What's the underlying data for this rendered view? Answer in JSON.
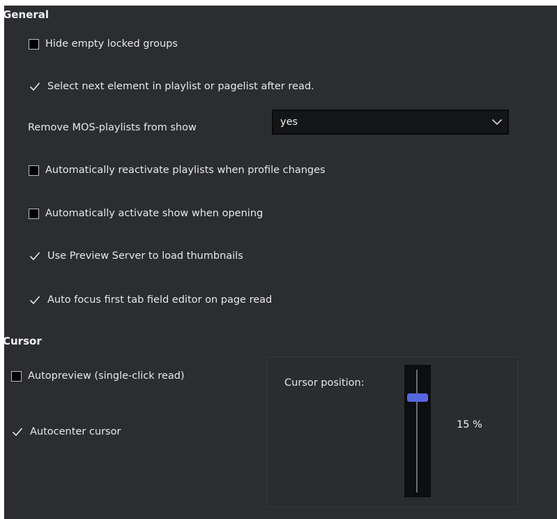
{
  "general": {
    "title": "General",
    "options": [
      {
        "label": "Hide empty locked groups",
        "type": "checkbox",
        "checked": false
      },
      {
        "label": "Select next element in playlist or pagelist after read.",
        "type": "check",
        "checked": true
      },
      {
        "label": "Automatically reactivate playlists when profile changes",
        "type": "checkbox",
        "checked": false
      },
      {
        "label": "Automatically activate show when opening",
        "type": "checkbox",
        "checked": false
      },
      {
        "label": "Use Preview Server to load thumbnails",
        "type": "check",
        "checked": true
      },
      {
        "label": "Auto focus first tab field editor on page read",
        "type": "check",
        "checked": true
      }
    ],
    "remove_mos": {
      "label": "Remove MOS-playlists from show",
      "value": "yes"
    }
  },
  "cursor": {
    "title": "Cursor",
    "autopreview": {
      "label": "Autopreview (single-click read)",
      "checked": false
    },
    "autocenter": {
      "label": "Autocenter cursor",
      "checked": true
    },
    "position_label": "Cursor position:",
    "position_value": 15,
    "position_text": "15 %"
  },
  "colors": {
    "panel": "#2b2d30",
    "accent": "#5567e0",
    "dropdown_bg": "#141517"
  }
}
